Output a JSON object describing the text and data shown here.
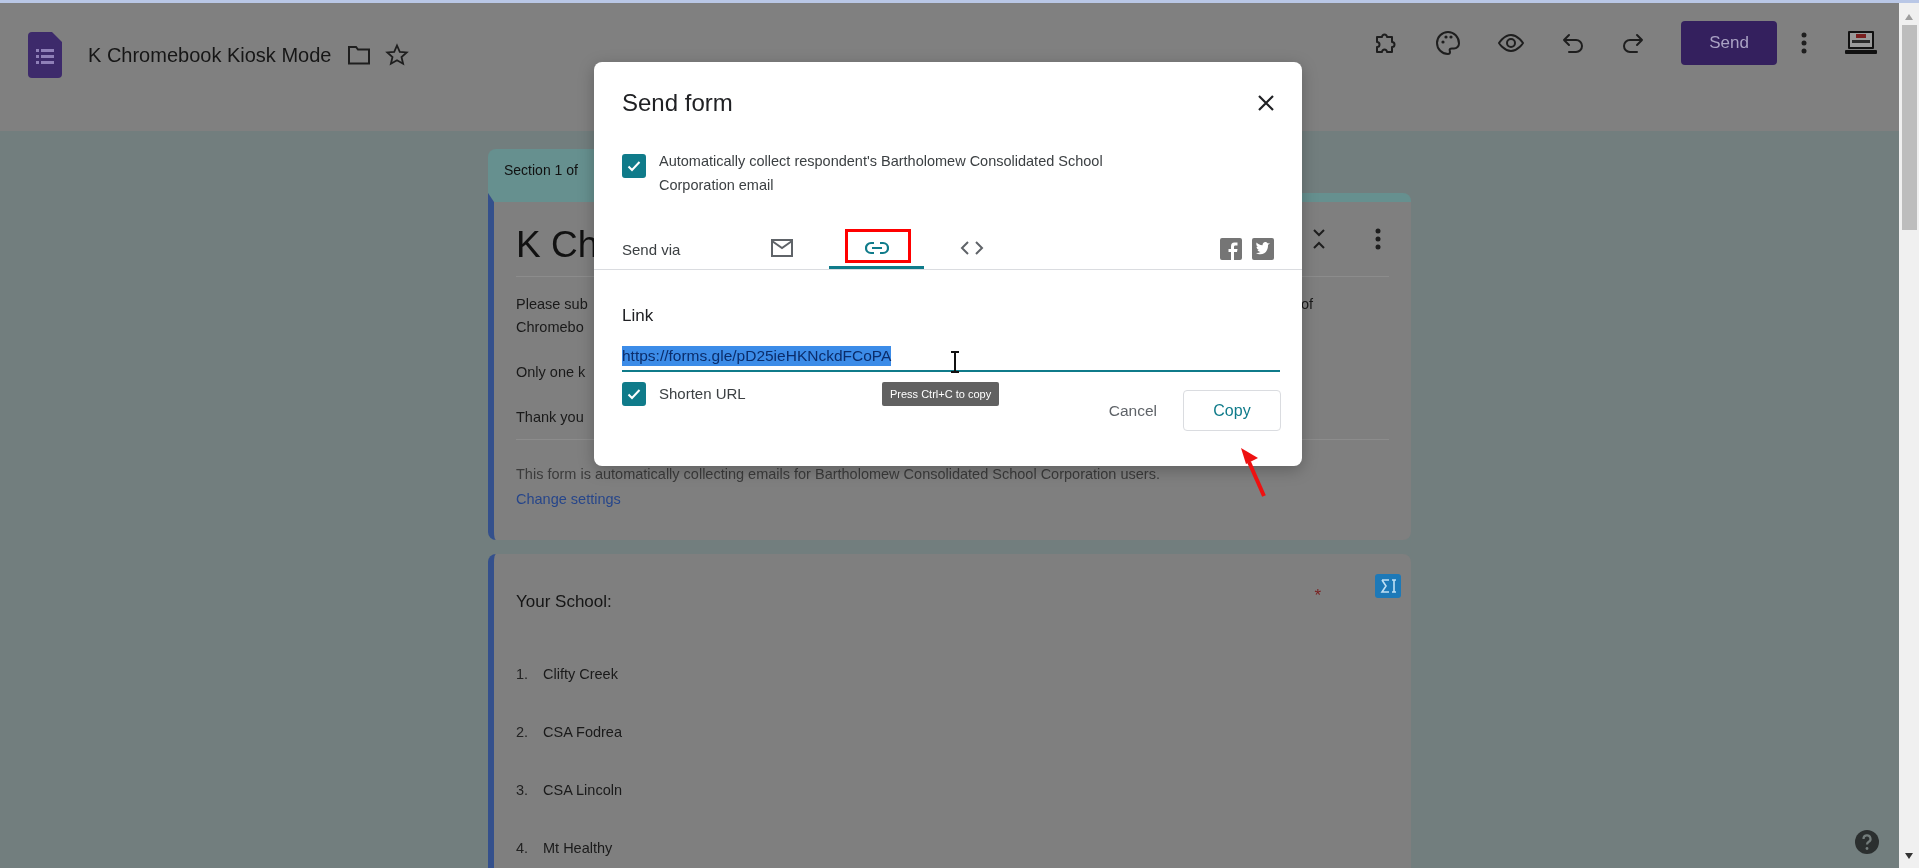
{
  "app_bar": {
    "title": "K Chromebook Kiosk Mode",
    "send_button": "Send"
  },
  "form": {
    "section_tab": "Section 1 of",
    "title": "K Ch",
    "description": [
      {
        "left": "Please sub",
        "right": "of"
      },
      {
        "left": "Chromebo"
      },
      {
        "left": "Only one k"
      },
      {
        "left": "Thank you"
      }
    ],
    "notice": "This form is automatically collecting emails for Bartholomew Consolidated School Corporation users.",
    "notice_link": "Change settings"
  },
  "question": {
    "title": "Your School:",
    "required_mark": "*",
    "options": [
      {
        "number": "1.",
        "name": "Clifty Creek"
      },
      {
        "number": "2.",
        "name": "CSA Fodrea"
      },
      {
        "number": "3.",
        "name": "CSA Lincoln"
      },
      {
        "number": "4.",
        "name": "Mt Healthy"
      }
    ]
  },
  "dialog": {
    "title": "Send form",
    "collect_emails": {
      "label": "Automatically collect respondent's Bartholomew Consolidated School Corporation email",
      "checked": true
    },
    "send_via_label": "Send via",
    "tabs": [
      {
        "kind": "email",
        "selected": false
      },
      {
        "kind": "link",
        "selected": true
      },
      {
        "kind": "embed",
        "selected": false
      }
    ],
    "link_heading": "Link",
    "link_url": "https://forms.gle/pD25ieHKNckdFCoPA",
    "url_selected": true,
    "tooltip": "Press Ctrl+C to copy",
    "shorten_url": {
      "label": "Shorten URL",
      "checked": true
    },
    "cancel_button": "Cancel",
    "copy_button": "Copy"
  }
}
